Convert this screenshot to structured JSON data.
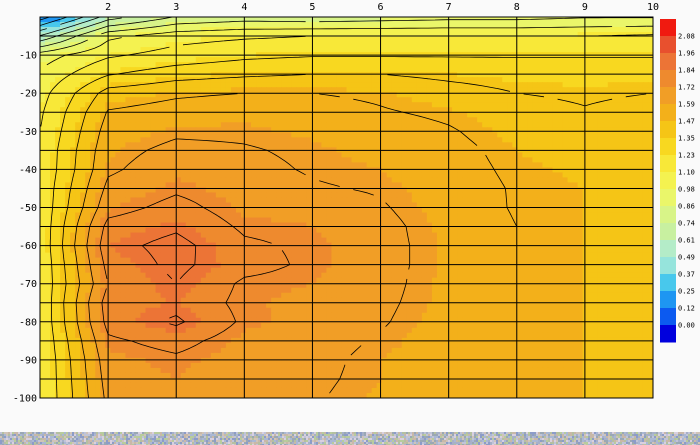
{
  "chart_data": {
    "type": "heatmap",
    "subtype": "filled-contour",
    "title": "",
    "xlabel": "",
    "ylabel": "",
    "x_ticks": [
      "2",
      "3",
      "4",
      "5",
      "6",
      "7",
      "8",
      "9",
      "10"
    ],
    "y_ticks": [
      "-10",
      "-20",
      "-30",
      "-40",
      "-50",
      "-60",
      "-70",
      "-80",
      "-90",
      "-100"
    ],
    "xlim": [
      1,
      10
    ],
    "ylim": [
      -100,
      0
    ],
    "colorbar": {
      "placement": "right",
      "ticks": [
        "0.00",
        "0.12",
        "0.25",
        "0.37",
        "0.49",
        "0.61",
        "0.74",
        "0.86",
        "0.98",
        "1.10",
        "1.23",
        "1.35",
        "1.47",
        "1.59",
        "1.72",
        "1.84",
        "1.96",
        "2.08"
      ],
      "colors": [
        "#0000dd",
        "#0c5af0",
        "#1e96f2",
        "#48c8ec",
        "#96e4dc",
        "#b4ecc8",
        "#c8f0a0",
        "#d8f488",
        "#eaf66a",
        "#f4f250",
        "#f8e838",
        "#f8d820",
        "#f5c516",
        "#f3b01a",
        "#f19e26",
        "#ee8a2e",
        "#ec7436",
        "#e8502e",
        "#f01a10"
      ]
    },
    "x": [
      1,
      2,
      3,
      4,
      5,
      6,
      7,
      8,
      9,
      10
    ],
    "y": [
      0,
      -5,
      -10,
      -15,
      -20,
      -25,
      -30,
      -35,
      -40,
      -45,
      -50,
      -55,
      -60,
      -65,
      -70,
      -75,
      -80,
      -85,
      -90,
      -95,
      -100
    ],
    "z": [
      [
        0.05,
        0.55,
        0.75,
        0.8,
        0.78,
        0.8,
        0.82,
        0.82,
        0.85,
        0.85
      ],
      [
        0.5,
        0.95,
        1.05,
        1.08,
        1.1,
        1.1,
        1.1,
        1.1,
        1.1,
        1.12
      ],
      [
        0.92,
        1.08,
        1.15,
        1.2,
        1.22,
        1.22,
        1.22,
        1.22,
        1.22,
        1.22
      ],
      [
        1.0,
        1.22,
        1.3,
        1.33,
        1.35,
        1.35,
        1.32,
        1.3,
        1.3,
        1.3
      ],
      [
        1.05,
        1.4,
        1.45,
        1.47,
        1.47,
        1.45,
        1.4,
        1.35,
        1.33,
        1.35
      ],
      [
        1.08,
        1.48,
        1.52,
        1.55,
        1.52,
        1.48,
        1.45,
        1.4,
        1.36,
        1.4
      ],
      [
        1.1,
        1.52,
        1.57,
        1.57,
        1.55,
        1.52,
        1.48,
        1.42,
        1.36,
        1.42
      ],
      [
        1.12,
        1.55,
        1.62,
        1.6,
        1.57,
        1.54,
        1.5,
        1.44,
        1.42,
        1.42
      ],
      [
        1.12,
        1.57,
        1.66,
        1.62,
        1.58,
        1.56,
        1.51,
        1.45,
        1.43,
        1.42
      ],
      [
        1.13,
        1.62,
        1.7,
        1.65,
        1.6,
        1.58,
        1.52,
        1.46,
        1.44,
        1.42
      ],
      [
        1.13,
        1.67,
        1.76,
        1.66,
        1.65,
        1.6,
        1.53,
        1.46,
        1.44,
        1.41
      ],
      [
        1.13,
        1.76,
        1.82,
        1.7,
        1.68,
        1.62,
        1.54,
        1.47,
        1.44,
        1.4
      ],
      [
        1.13,
        1.8,
        1.88,
        1.74,
        1.7,
        1.62,
        1.55,
        1.47,
        1.44,
        1.4
      ],
      [
        1.12,
        1.76,
        1.87,
        1.76,
        1.7,
        1.62,
        1.55,
        1.47,
        1.44,
        1.4
      ],
      [
        1.12,
        1.72,
        1.84,
        1.7,
        1.68,
        1.62,
        1.54,
        1.47,
        1.44,
        1.4
      ],
      [
        1.12,
        1.78,
        1.8,
        1.69,
        1.66,
        1.61,
        1.54,
        1.47,
        1.44,
        1.4
      ],
      [
        1.12,
        1.76,
        1.86,
        1.7,
        1.65,
        1.6,
        1.53,
        1.47,
        1.44,
        1.4
      ],
      [
        1.11,
        1.7,
        1.76,
        1.66,
        1.63,
        1.58,
        1.52,
        1.47,
        1.44,
        1.4
      ],
      [
        1.1,
        1.66,
        1.7,
        1.64,
        1.62,
        1.56,
        1.52,
        1.47,
        1.44,
        1.4
      ],
      [
        1.1,
        1.64,
        1.68,
        1.62,
        1.61,
        1.56,
        1.52,
        1.47,
        1.44,
        1.4
      ],
      [
        1.1,
        1.62,
        1.66,
        1.62,
        1.6,
        1.55,
        1.51,
        1.47,
        1.44,
        1.4
      ]
    ],
    "grid": true
  }
}
